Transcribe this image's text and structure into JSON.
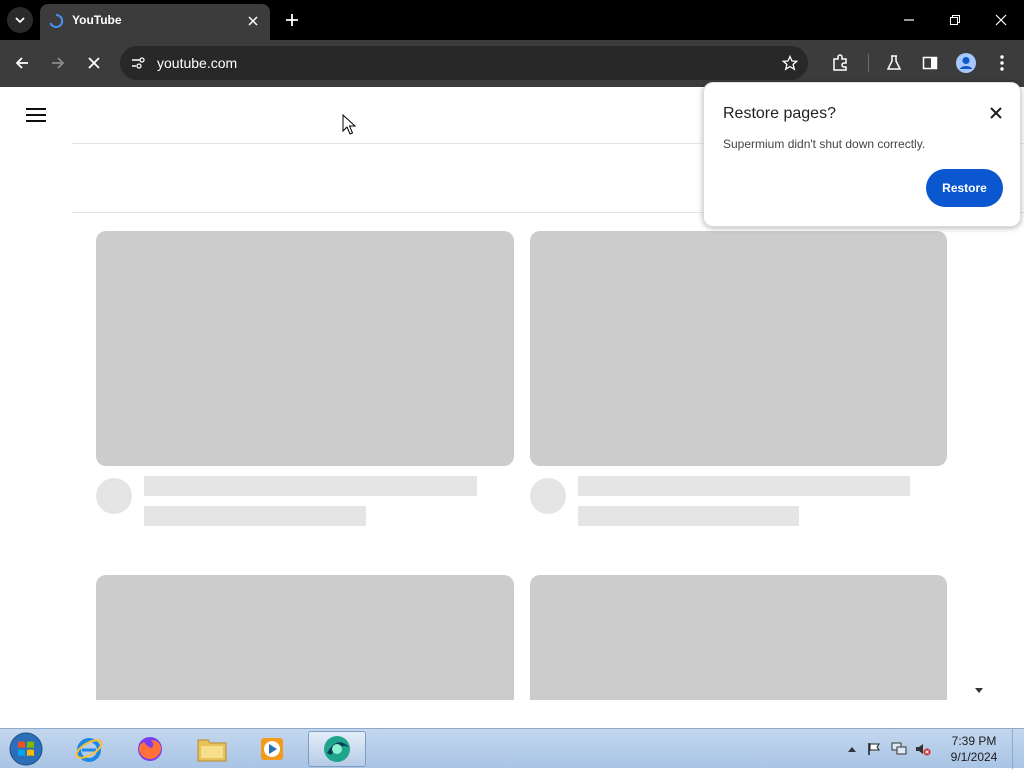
{
  "browser": {
    "tab": {
      "title": "YouTube",
      "favicon": "loading-spinner-icon"
    },
    "url": "youtube.com",
    "window_controls": [
      "minimize-icon",
      "maximize-icon",
      "close-icon"
    ],
    "toolbar_icons": [
      "back-icon",
      "forward-icon",
      "stop-icon",
      "site-info-icon",
      "star-icon",
      "extensions-icon",
      "labs-icon",
      "side-panel-icon",
      "profile-icon",
      "menu-icon"
    ]
  },
  "restore_popup": {
    "title": "Restore pages?",
    "message": "Supermium didn't shut down correctly.",
    "button_label": "Restore"
  },
  "colors": {
    "accent": "#0b57d0",
    "skeleton_thumb": "#cccccc",
    "skeleton_line": "#e5e5e5",
    "toolbar": "#3c3c3c",
    "tabstrip": "#000000"
  },
  "taskbar": {
    "apps": [
      "internet-explorer-icon",
      "firefox-icon",
      "file-explorer-icon",
      "media-player-icon",
      "supermium-icon"
    ],
    "clock": {
      "time": "7:39 PM",
      "date": "9/1/2024"
    }
  }
}
